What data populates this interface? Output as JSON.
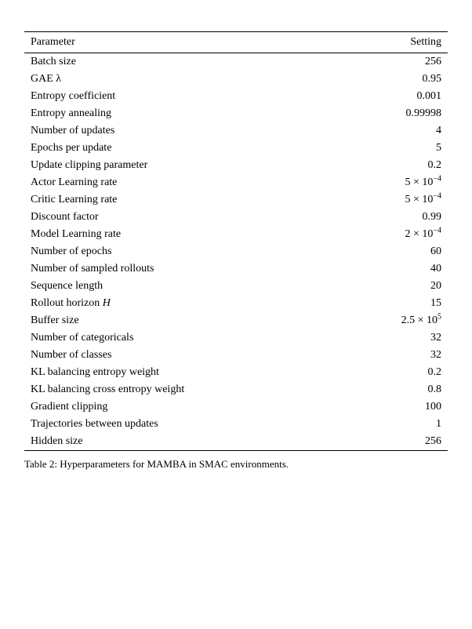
{
  "table": {
    "col_parameter": "Parameter",
    "col_setting": "Setting",
    "rows": [
      {
        "parameter": "Batch size",
        "setting": "256",
        "setting_html": false
      },
      {
        "parameter": "GAE λ",
        "setting": "0.95",
        "setting_html": false
      },
      {
        "parameter": "Entropy coefficient",
        "setting": "0.001",
        "setting_html": false
      },
      {
        "parameter": "Entropy annealing",
        "setting": "0.99998",
        "setting_html": false
      },
      {
        "parameter": "Number of updates",
        "setting": "4",
        "setting_html": false
      },
      {
        "parameter": "Epochs per update",
        "setting": "5",
        "setting_html": false
      },
      {
        "parameter": "Update clipping parameter",
        "setting": "0.2",
        "setting_html": false
      },
      {
        "parameter": "Actor Learning rate",
        "setting": "5 × 10⁻⁴",
        "setting_html": true,
        "html": "5 &times; 10<sup>&minus;4</sup>"
      },
      {
        "parameter": "Critic Learning rate",
        "setting": "5 × 10⁻⁴",
        "setting_html": true,
        "html": "5 &times; 10<sup>&minus;4</sup>"
      },
      {
        "parameter": "Discount factor",
        "setting": "0.99",
        "setting_html": false
      },
      {
        "parameter": "Model Learning rate",
        "setting": "2 × 10⁻⁴",
        "setting_html": true,
        "html": "2 &times; 10<sup>&minus;4</sup>"
      },
      {
        "parameter": "Number of epochs",
        "setting": "60",
        "setting_html": false
      },
      {
        "parameter": "Number of sampled rollouts",
        "setting": "40",
        "setting_html": false
      },
      {
        "parameter": "Sequence length",
        "setting": "20",
        "setting_html": false
      },
      {
        "parameter": "Rollout horizon H",
        "setting": "15",
        "setting_html": false
      },
      {
        "parameter": "Buffer size",
        "setting": "2.5 × 10⁵",
        "setting_html": true,
        "html": "2.5 &times; 10<sup>5</sup>"
      },
      {
        "parameter": "Number of categoricals",
        "setting": "32",
        "setting_html": false
      },
      {
        "parameter": "Number of classes",
        "setting": "32",
        "setting_html": false
      },
      {
        "parameter": "KL balancing entropy weight",
        "setting": "0.2",
        "setting_html": false
      },
      {
        "parameter": "KL balancing cross entropy weight",
        "setting": "0.8",
        "setting_html": false
      },
      {
        "parameter": "Gradient clipping",
        "setting": "100",
        "setting_html": false
      },
      {
        "parameter": "Trajectories between updates",
        "setting": "1",
        "setting_html": false
      },
      {
        "parameter": "Hidden size",
        "setting": "256",
        "setting_html": false
      }
    ]
  },
  "caption": "Table 2: Hyperparameters for MAMBA in SMAC environments."
}
